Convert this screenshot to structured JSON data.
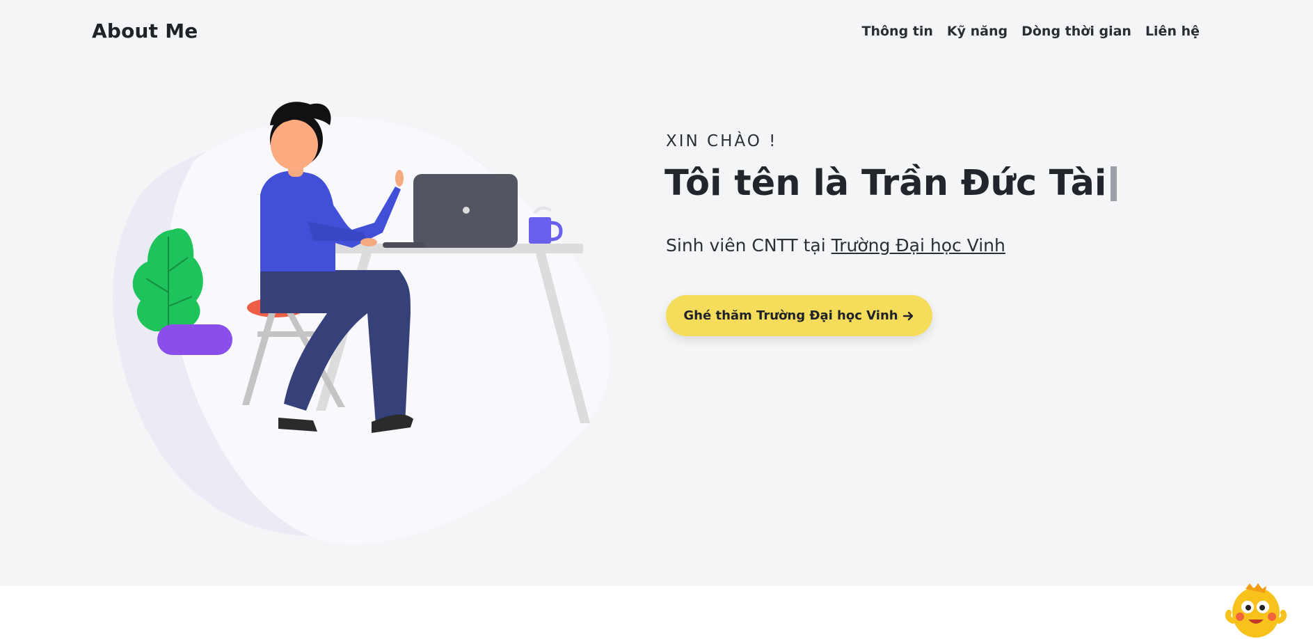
{
  "header": {
    "brand": "About Me",
    "nav": [
      {
        "label": "Thông tin"
      },
      {
        "label": "Kỹ năng"
      },
      {
        "label": "Dòng thời gian"
      },
      {
        "label": "Liên hệ"
      }
    ]
  },
  "hero": {
    "greeting": "XIN CHÀO !",
    "headline": "Tôi tên là Trần Đức Tài",
    "subtitle_prefix": "Sinh viên CNTT tại ",
    "subtitle_link": "Trường Đại học Vinh",
    "cta_label": "Ghé thăm Trường Đại học Vinh",
    "cta_icon": "arrow-right-icon"
  },
  "colors": {
    "background": "#f4f5f7",
    "cta": "#f5dc5b",
    "text": "#22252b"
  }
}
